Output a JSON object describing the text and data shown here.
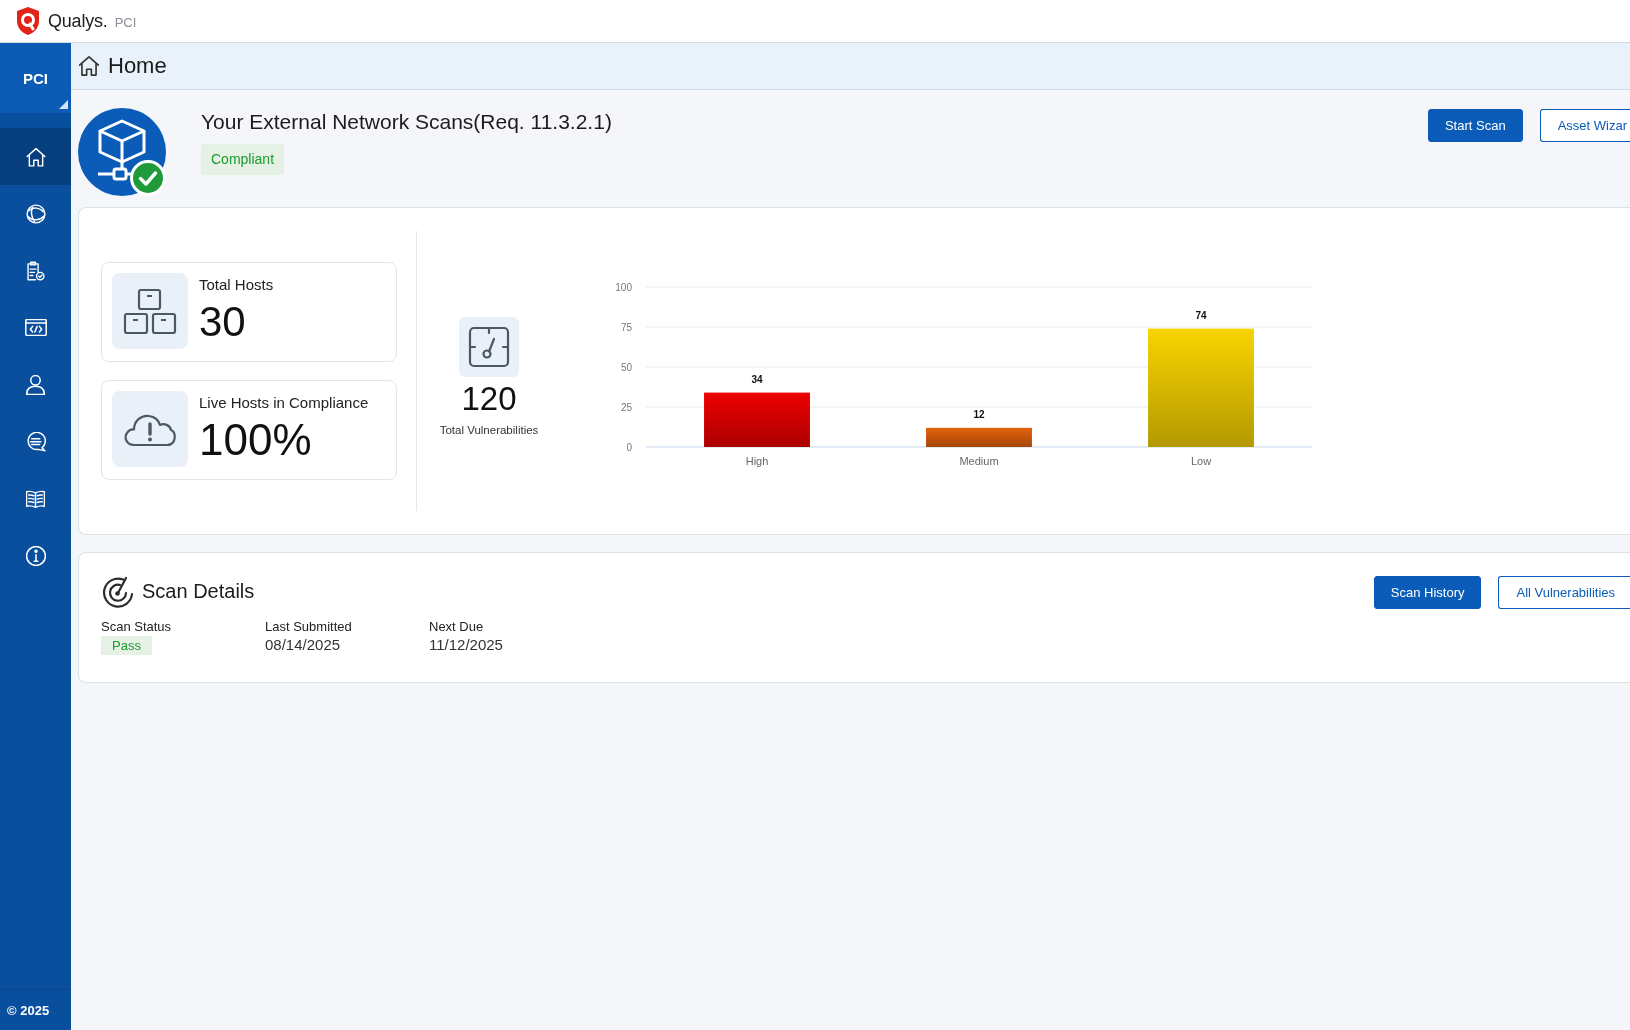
{
  "header": {
    "logo_text": "Qualys.",
    "product": "PCI"
  },
  "sidebar": {
    "section": "PCI",
    "items": [
      {
        "kind": "home",
        "selected": true
      },
      {
        "kind": "globe",
        "selected": false
      },
      {
        "kind": "report",
        "selected": false
      },
      {
        "kind": "code",
        "selected": false
      },
      {
        "kind": "user",
        "selected": false
      },
      {
        "kind": "chat",
        "selected": false
      },
      {
        "kind": "book",
        "selected": false
      },
      {
        "kind": "info",
        "selected": false
      }
    ],
    "footer": "© 2025"
  },
  "breadcrumb": {
    "title": "Home"
  },
  "scan_summary": {
    "title": "Your External Network Scans(Req. 11.3.2.1)",
    "status": "Compliant",
    "buttons": [
      {
        "label": "Start Scan",
        "kind": "primary"
      },
      {
        "label": "Asset Wizar",
        "kind": "secondary"
      }
    ]
  },
  "stats": [
    {
      "kind": "hosts",
      "label": "Total Hosts",
      "value": "30"
    },
    {
      "kind": "compliance",
      "label": "Live Hosts in Compliance",
      "value": "100%"
    }
  ],
  "vulnerabilities": {
    "value": "120",
    "label": "Total Vulnerabilities",
    "chart_data": {
      "type": "bar",
      "categories": [
        "High",
        "Medium",
        "Low"
      ],
      "values": [
        34,
        12,
        74
      ],
      "colors": [
        "#ee0000",
        "#e4620c",
        "#f8d400"
      ],
      "ylim": [
        0,
        100
      ],
      "yticks": [
        0,
        25,
        50,
        75,
        100
      ],
      "grid": true,
      "data_labels": true
    }
  },
  "scan_details": {
    "title": "Scan Details",
    "fields": [
      {
        "label": "Scan Status",
        "value": "Pass",
        "kind": "badge"
      },
      {
        "label": "Last Submitted",
        "value": "08/14/2025",
        "kind": "text"
      },
      {
        "label": "Next Due",
        "value": "11/12/2025",
        "kind": "text"
      }
    ],
    "buttons": [
      {
        "label": "Scan History",
        "kind": "primary"
      },
      {
        "label": "All Vulnerabilities",
        "kind": "secondary"
      }
    ]
  }
}
